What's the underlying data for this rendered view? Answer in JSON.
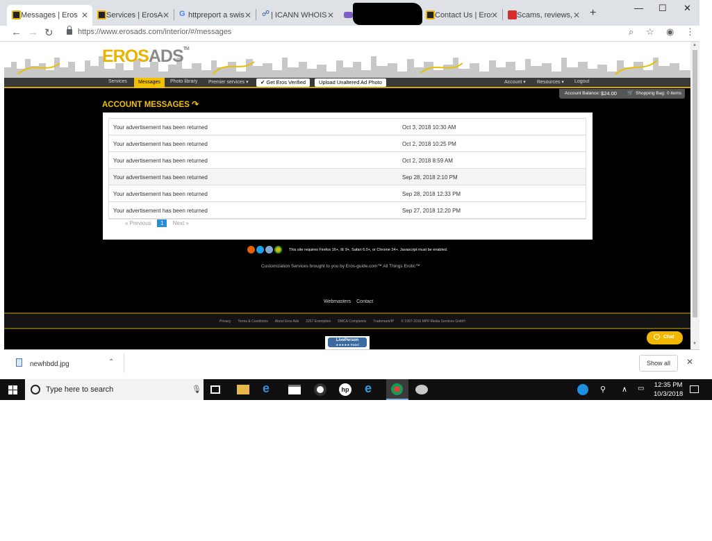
{
  "browser": {
    "tabs": [
      {
        "title": "Messages | ErosA",
        "favicon": "erosads-favicon",
        "active": true
      },
      {
        "title": "Services | ErosAd",
        "favicon": "erosads-favicon",
        "active": false
      },
      {
        "title": "httpreport a swis",
        "favicon": "google-g-icon",
        "active": false
      },
      {
        "title": "| ICANN WHOIS",
        "favicon": "icann-icon",
        "active": false
      },
      {
        "title": "",
        "favicon": "mail-icon",
        "active": false
      },
      {
        "title": "Contact Us | Eros",
        "favicon": "erosads-favicon",
        "active": false
      },
      {
        "title": "Scams, reviews, c",
        "favicon": "scam-site-icon",
        "active": false
      }
    ],
    "url": "https://www.erosads.com/interior/#/messages",
    "window_controls": {
      "minimize": "—",
      "maximize": "☐",
      "close": "✕"
    }
  },
  "site": {
    "logo": {
      "eros": "EROS",
      "ads": "ADS",
      "tm": "TM"
    },
    "nav": {
      "services": "Services",
      "messages": "Messages",
      "photo_library": "Photo library",
      "premier_services": "Premier services ▾",
      "get_verified": "✔ Get Eros Verified",
      "upload_unaltered": "Upload Unaltered Ad Photo",
      "account": "Account ▾",
      "resources": "Resources ▾",
      "logout": "Logout"
    },
    "balance": {
      "label": "Account Balance:",
      "amount": "$24.00",
      "bag_label": "Shopping Bag:",
      "bag_items": "0 items"
    },
    "title": "ACCOUNT MESSAGES",
    "messages": [
      {
        "subject": "Your advertisement has been returned",
        "date": "Oct 3, 2018 10:30 AM",
        "shaded": false
      },
      {
        "subject": "Your advertisement has been returned",
        "date": "Oct 2, 2018 10:25 PM",
        "shaded": false
      },
      {
        "subject": "Your advertisement has been returned",
        "date": "Oct 2, 2018 8:59 AM",
        "shaded": false
      },
      {
        "subject": "Your advertisement has been returned",
        "date": "Sep 28, 2018 2:10 PM",
        "shaded": true
      },
      {
        "subject": "Your advertisement has been returned",
        "date": "Sep 28, 2018 12:33 PM",
        "shaded": false
      },
      {
        "subject": "Your advertisement has been returned",
        "date": "Sep 27, 2018 12:20 PM",
        "shaded": false
      }
    ],
    "pager": {
      "previous": "« Previous",
      "page": "1",
      "next": "Next »"
    },
    "requirements": "This site requires Firefox 16+, IE 9+, Safari 6.0+, or Chrome 24+. Javascript must be enabled.",
    "customization": "Customization Services brought to you by Eros-guide.com™ All Things Erotic™",
    "mid_links": {
      "webmasters": "Webmasters",
      "contact": "Contact"
    },
    "footer_links": [
      "Privacy",
      "Terms & Conditions",
      "About Eros Ads",
      "2257 Exemption",
      "DMCA Complaints",
      "Trademark/IP",
      "© 1997-2016 MPF Media Services GmbH"
    ],
    "liveperson": {
      "line1": "LivePerson",
      "line2": "★★★★★ Rated"
    },
    "chat": "Chat"
  },
  "downloads": {
    "file": "newhbdd.jpg",
    "show_all": "Show all"
  },
  "taskbar": {
    "search_placeholder": "Type here to search",
    "time": "12:35 PM",
    "date": "10/3/2018"
  },
  "colors": {
    "accent_yellow": "#f2c200",
    "page_number_blue": "#2a8dd4"
  }
}
